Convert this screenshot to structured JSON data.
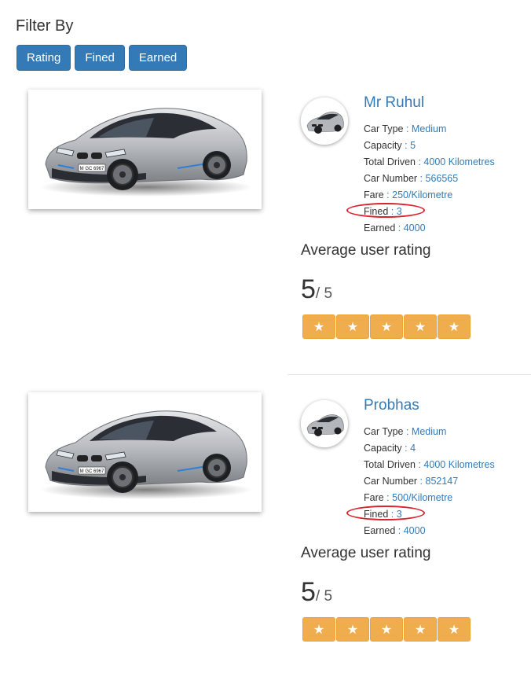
{
  "filter": {
    "title": "Filter By",
    "buttons": [
      "Rating",
      "Fined",
      "Earned"
    ]
  },
  "drivers": [
    {
      "name": "Mr Ruhul",
      "details": [
        {
          "label": "Car Type",
          "value": "Medium"
        },
        {
          "label": "Capacity",
          "value": "5"
        },
        {
          "label": "Total Driven",
          "value": "4000 Kilometres"
        },
        {
          "label": "Car Number",
          "value": "566565"
        },
        {
          "label": "Fare",
          "value": "250/Kilometre"
        },
        {
          "label": "Fined",
          "value": "3"
        },
        {
          "label": "Earned",
          "value": "4000"
        }
      ],
      "rating_title": "Average user rating",
      "rating": "5",
      "rating_max": "/ 5",
      "stars": 5,
      "plate": "M GC 6967"
    },
    {
      "name": "Probhas",
      "details": [
        {
          "label": "Car Type",
          "value": "Medium"
        },
        {
          "label": "Capacity",
          "value": "4"
        },
        {
          "label": "Total Driven",
          "value": "4000 Kilometres"
        },
        {
          "label": "Car Number",
          "value": "852147"
        },
        {
          "label": "Fare",
          "value": "500/Kilometre"
        },
        {
          "label": "Fined",
          "value": "3"
        },
        {
          "label": "Earned",
          "value": "4000"
        }
      ],
      "rating_title": "Average user rating",
      "rating": "5",
      "rating_max": "/ 5",
      "stars": 5,
      "plate": "M GC 6967"
    }
  ],
  "star_glyph": "★",
  "colors": {
    "primary": "#337ab7",
    "star": "#f0ad4e",
    "highlight": "#d9232d"
  }
}
